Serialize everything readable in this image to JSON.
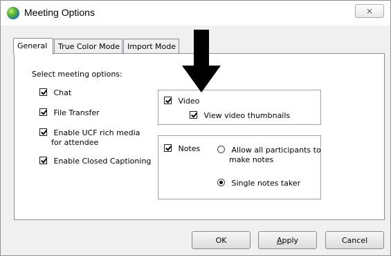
{
  "window": {
    "title": "Meeting Options"
  },
  "tabs": [
    {
      "label": "General"
    },
    {
      "label": "True Color Mode"
    },
    {
      "label": "Import Mode"
    }
  ],
  "general": {
    "section_label": "Select meeting options:",
    "left_options": [
      {
        "label": "Chat",
        "checked": true
      },
      {
        "label": "File Transfer",
        "checked": true
      },
      {
        "label": "Enable UCF rich media",
        "label2": "for attendee",
        "checked": true
      },
      {
        "label": "Enable Closed Captioning",
        "checked": true
      }
    ],
    "video": {
      "label": "Video",
      "checked": true,
      "thumbnails_label": "View video thumbnails",
      "thumbnails_checked": true
    },
    "notes": {
      "label": "Notes",
      "checked": true,
      "radio_all_line1": "Allow all participants to",
      "radio_all_line2": "make notes",
      "radio_single": "Single notes taker",
      "selected": "single"
    }
  },
  "buttons": {
    "ok": "OK",
    "apply_u": "A",
    "apply_rest": "pply",
    "cancel": "Cancel"
  },
  "close_glyph": "⨯",
  "icons": [
    "meeting-app-icon",
    "close-icon",
    "down-arrow-icon"
  ]
}
